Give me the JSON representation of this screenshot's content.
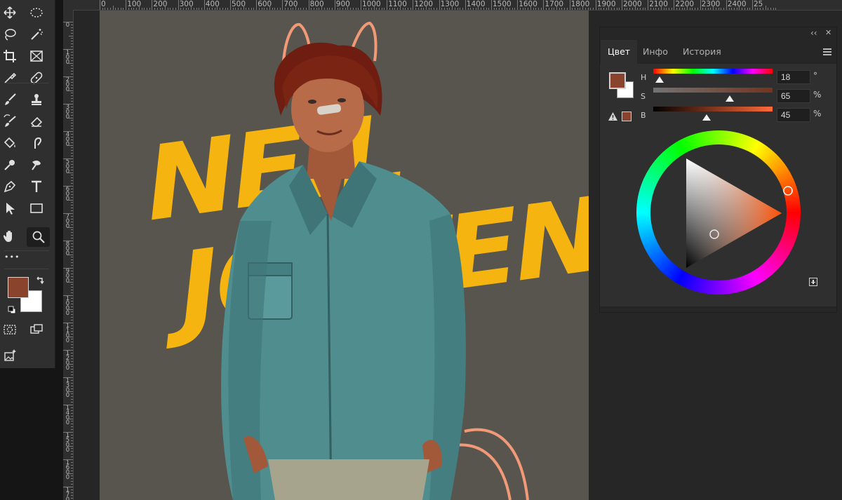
{
  "toolbar": {
    "tools": [
      {
        "name": "move-tool",
        "icon": "move-icon",
        "active": false
      },
      {
        "name": "elliptical-marquee-tool",
        "icon": "ellipse-marquee-icon",
        "active": false
      },
      {
        "name": "lasso-tool",
        "icon": "lasso-icon",
        "active": false
      },
      {
        "name": "magic-wand-tool",
        "icon": "magic-wand-icon",
        "active": false
      },
      {
        "name": "crop-tool",
        "icon": "crop-icon",
        "active": false
      },
      {
        "name": "frame-tool",
        "icon": "frame-icon",
        "active": false
      },
      {
        "name": "eyedropper-tool",
        "icon": "eyedropper-icon",
        "active": false
      },
      {
        "name": "healing-brush-tool",
        "icon": "bandage-icon",
        "active": false
      },
      {
        "name": "brush-tool",
        "icon": "brush-icon",
        "active": false
      },
      {
        "name": "clone-stamp-tool",
        "icon": "stamp-icon",
        "active": false
      },
      {
        "name": "history-brush-tool",
        "icon": "history-brush-icon",
        "active": false
      },
      {
        "name": "eraser-tool",
        "icon": "eraser-icon",
        "active": false
      },
      {
        "name": "paint-bucket-tool",
        "icon": "paint-bucket-icon",
        "active": false
      },
      {
        "name": "smudge-tool",
        "icon": "smudge-icon",
        "active": false
      },
      {
        "name": "dodge-tool",
        "icon": "dodge-icon",
        "active": false
      },
      {
        "name": "burn-tool",
        "icon": "burn-icon",
        "active": false
      },
      {
        "name": "pen-tool",
        "icon": "pen-icon",
        "active": false
      },
      {
        "name": "type-tool",
        "icon": "type-icon",
        "active": false
      },
      {
        "name": "path-selection-tool",
        "icon": "arrow-pointer-icon",
        "active": false
      },
      {
        "name": "rectangle-tool",
        "icon": "rectangle-icon",
        "active": false
      },
      {
        "name": "hand-tool",
        "icon": "hand-icon",
        "active": false
      },
      {
        "name": "zoom-tool",
        "icon": "zoom-icon",
        "active": true
      }
    ],
    "more_label": "•••",
    "foreground_color": "#8a432c",
    "background_color": "#ffffff"
  },
  "ruler": {
    "top_labels": [
      "0",
      "100",
      "200",
      "300",
      "400",
      "500",
      "600",
      "700",
      "800",
      "900",
      "1000",
      "1100",
      "1200",
      "1300",
      "1400",
      "1500",
      "1600",
      "1700",
      "1800",
      "1900",
      "2000",
      "2100",
      "2200",
      "2300",
      "2400",
      "25"
    ],
    "left_labels": [
      "0",
      "1\n0\n0",
      "2\n0\n0",
      "3\n0\n0",
      "4\n0\n0",
      "5\n0\n0",
      "6\n0\n0",
      "7\n0\n0",
      "8\n0\n0",
      "9\n0\n0",
      "1\n0\n0\n0",
      "1\n1\n0\n0",
      "1\n2\n0\n0",
      "1\n3\n0\n0",
      "1\n4\n0\n0",
      "1\n5\n0\n0",
      "1\n6\n0\n0",
      "1\n7\n0\n0"
    ]
  },
  "canvas": {
    "background_color": "#58554f",
    "poster_line1": "NEIL",
    "poster_line2": "JOSTEN",
    "poster_color": "#f5b40f"
  },
  "color_panel": {
    "tabs": [
      {
        "label": "Цвет",
        "active": true
      },
      {
        "label": "Инфо",
        "active": false
      },
      {
        "label": "История",
        "active": false
      }
    ],
    "collapse_label": "‹‹",
    "close_label": "✕",
    "menu_icon": "hamburger-menu-icon",
    "sliders": [
      {
        "label": "H",
        "value": "18",
        "unit": "°",
        "position": 0.05
      },
      {
        "label": "S",
        "value": "65",
        "unit": "%",
        "position": 0.65
      },
      {
        "label": "B",
        "value": "45",
        "unit": "%",
        "position": 0.45
      }
    ],
    "current_color": "#8a432c",
    "out_of_gamut_swatch": "#8a432c",
    "warning_icon": "gamut-warning-icon",
    "add_icon": "add-swatch-icon"
  }
}
